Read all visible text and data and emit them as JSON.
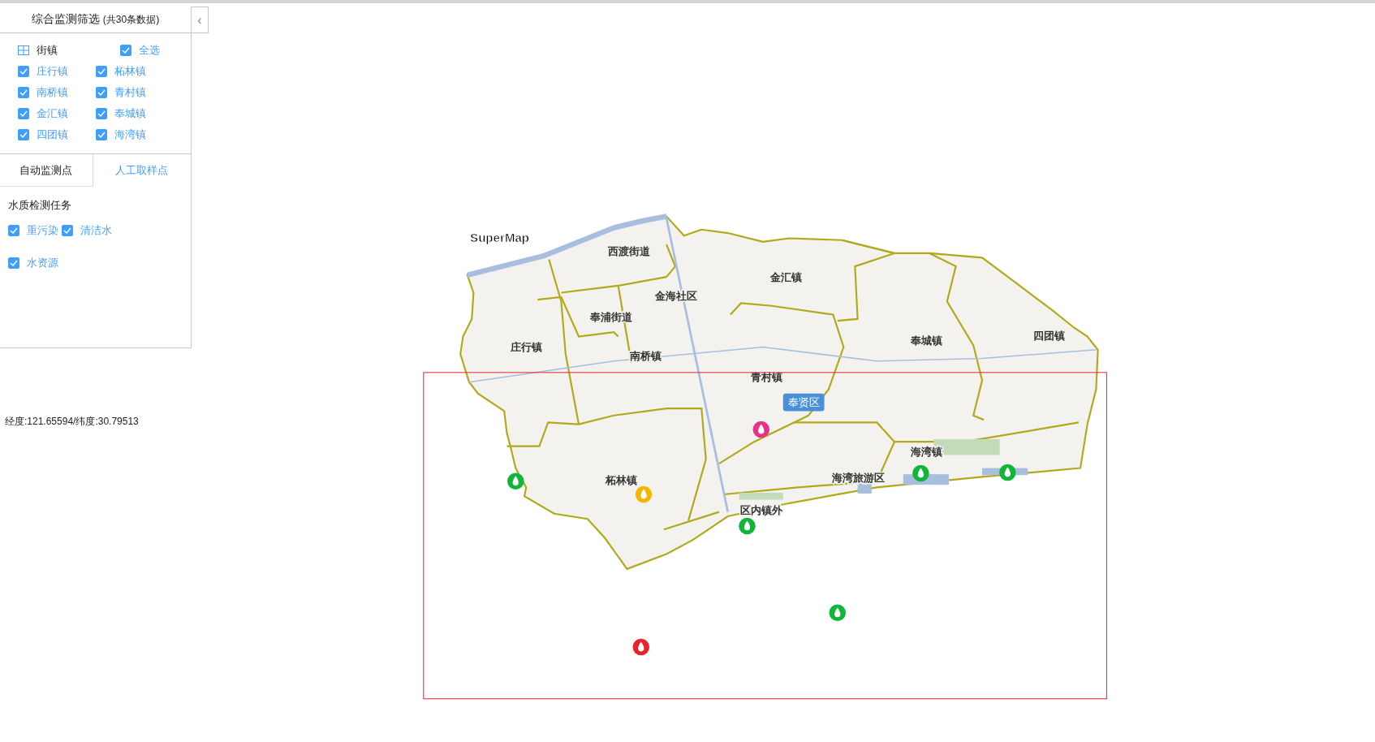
{
  "panel": {
    "title": "综合监测筛选",
    "count": "(共30条数据)",
    "collapse_icon": "‹",
    "towns": {
      "label": "街镇",
      "select_all": {
        "label": "全选",
        "checked": true
      },
      "items": [
        {
          "label": "庄行镇",
          "checked": true
        },
        {
          "label": "柘林镇",
          "checked": true
        },
        {
          "label": "南桥镇",
          "checked": true
        },
        {
          "label": "青村镇",
          "checked": true
        },
        {
          "label": "金汇镇",
          "checked": true
        },
        {
          "label": "奉城镇",
          "checked": true
        },
        {
          "label": "四团镇",
          "checked": true
        },
        {
          "label": "海湾镇",
          "checked": true
        }
      ]
    },
    "tabs": [
      {
        "label": "自动监测点",
        "selected": false
      },
      {
        "label": "人工取样点",
        "selected": true
      }
    ],
    "tasks": {
      "title": "水质检测任务",
      "items": [
        {
          "label": "重污染",
          "checked": true
        },
        {
          "label": "清洁水",
          "checked": true
        },
        {
          "label": "水资源",
          "checked": true
        }
      ]
    }
  },
  "coordinates": "经度:121.65594/纬度:30.79513",
  "map": {
    "logo": "SuperMap",
    "labels": [
      {
        "text": "西渡街道"
      },
      {
        "text": "金汇镇"
      },
      {
        "text": "金海社区"
      },
      {
        "text": "奉浦街道"
      },
      {
        "text": "庄行镇"
      },
      {
        "text": "南桥镇"
      },
      {
        "text": "奉城镇"
      },
      {
        "text": "四团镇"
      },
      {
        "text": "青村镇"
      },
      {
        "text": "海湾镇"
      },
      {
        "text": "柘林镇"
      },
      {
        "text": "海湾旅游区"
      },
      {
        "text": "区内镇外"
      }
    ],
    "district_badge": "奉贤区",
    "markers": [
      {
        "color": "#e8318a"
      },
      {
        "color": "#11b53a"
      },
      {
        "color": "#f2b705"
      },
      {
        "color": "#11b53a"
      },
      {
        "color": "#11b53a"
      },
      {
        "color": "#11b53a"
      },
      {
        "color": "#11b53a"
      },
      {
        "color": "#e8232a"
      }
    ]
  }
}
